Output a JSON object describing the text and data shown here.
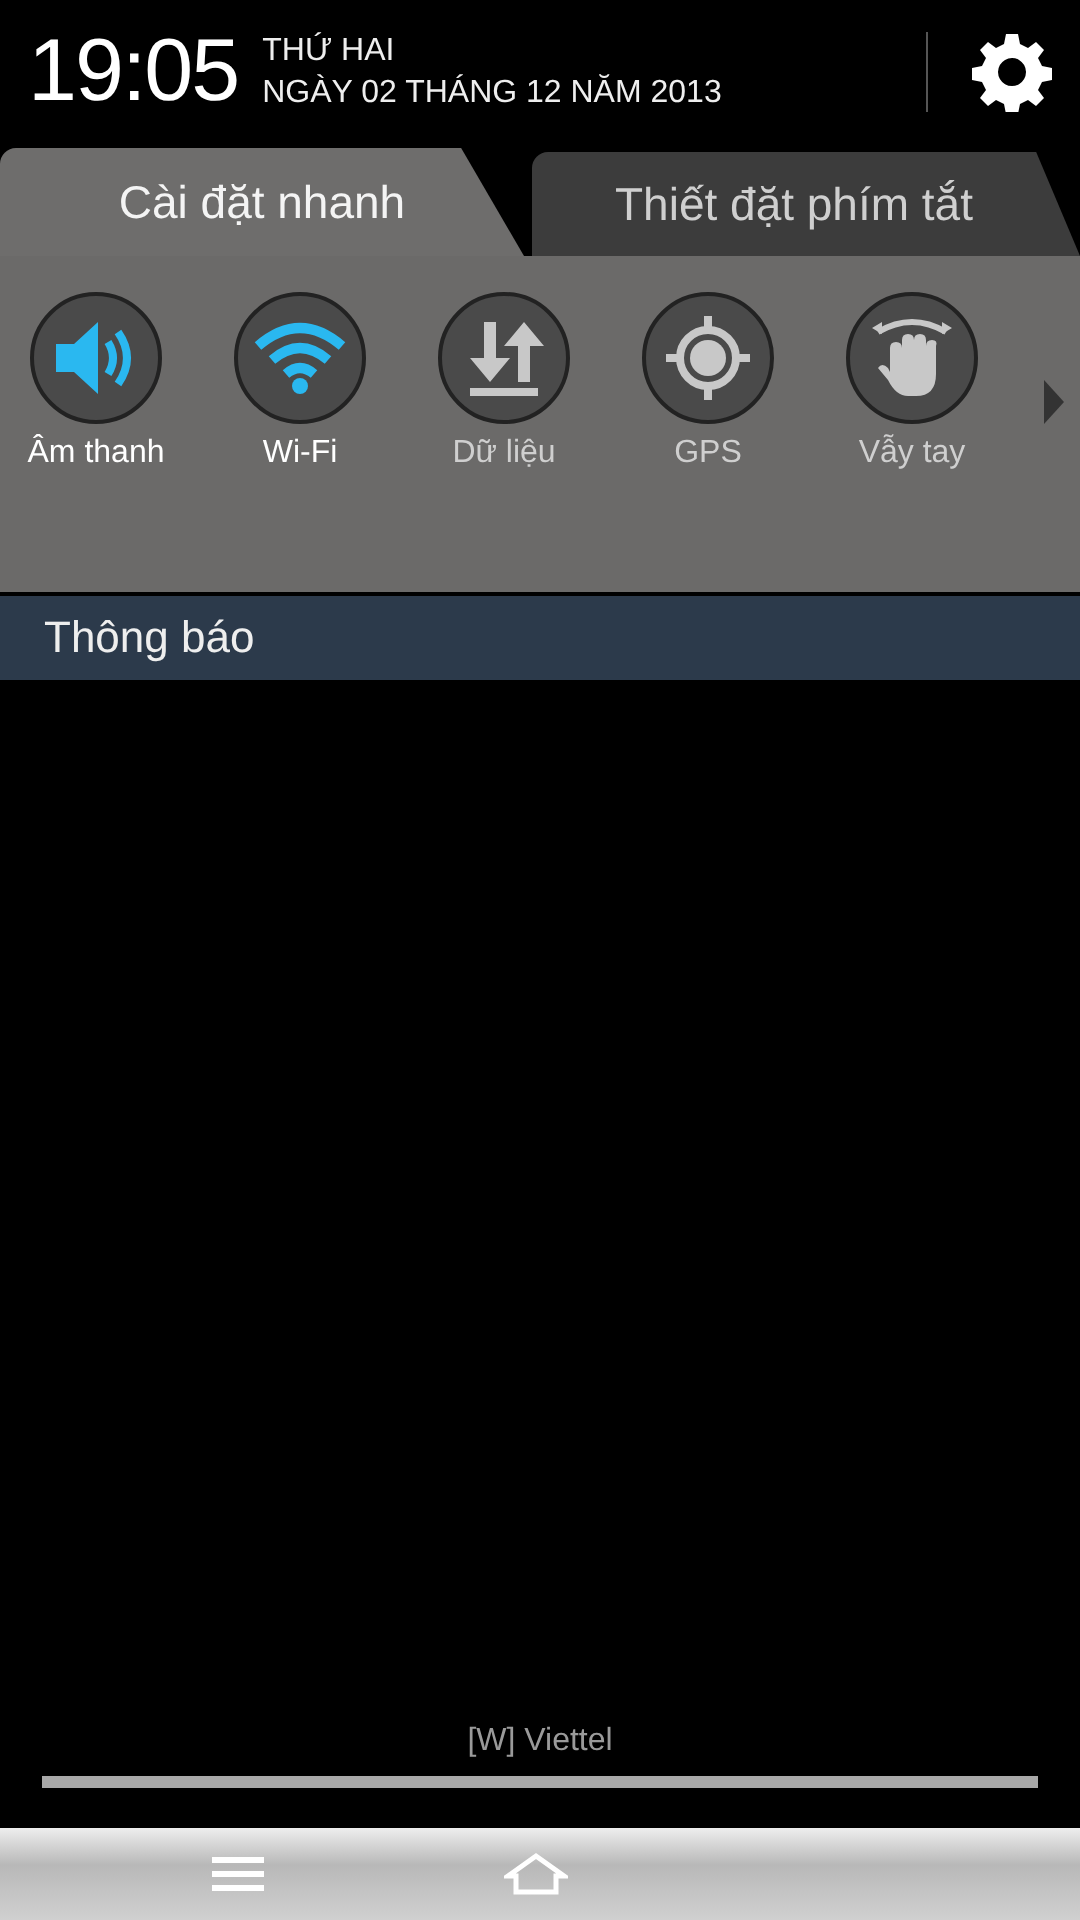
{
  "status": {
    "time": "19:05",
    "day": "THỨ HAI",
    "date": "NGÀY 02 THÁNG 12 NĂM 2013"
  },
  "tabs": [
    {
      "label": "Cài đặt nhanh",
      "selected": true
    },
    {
      "label": "Thiết đặt phím tắt",
      "selected": false
    }
  ],
  "toggles": [
    {
      "kind": "sound",
      "label": "Âm thanh",
      "on": true
    },
    {
      "kind": "wifi",
      "label": "Wi-Fi",
      "on": true
    },
    {
      "kind": "data",
      "label": "Dữ liệu",
      "on": false
    },
    {
      "kind": "gps",
      "label": "GPS",
      "on": false
    },
    {
      "kind": "gesture",
      "label": "Vẫy tay",
      "on": false
    }
  ],
  "notifications": {
    "title": "Thông báo"
  },
  "carrier": "[W] Viettel"
}
